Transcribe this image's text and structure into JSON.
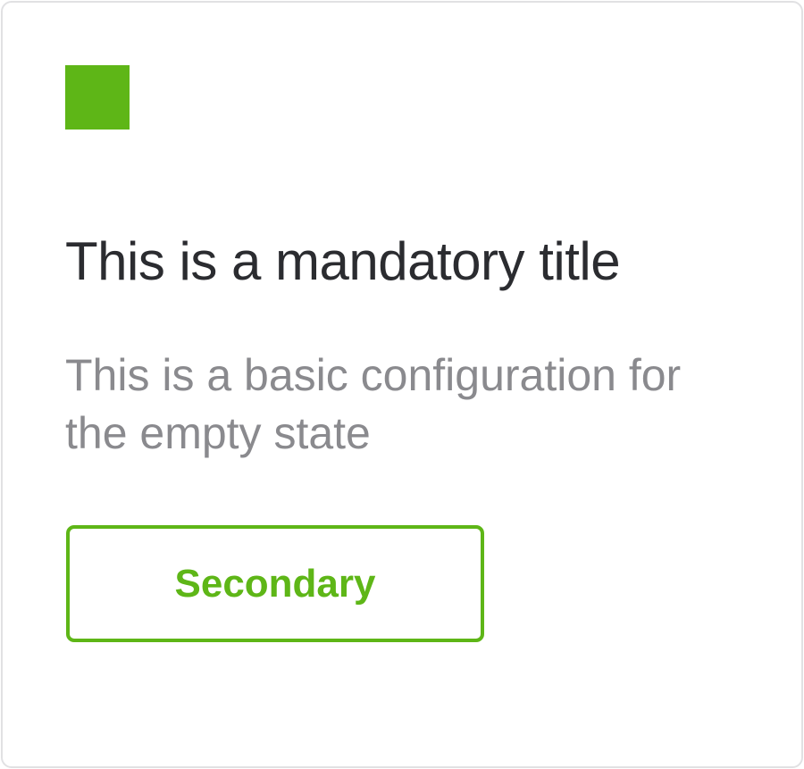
{
  "empty_state": {
    "illustration": {
      "icon": "green-square-icon",
      "color": "#5EB617"
    },
    "title": "This is a mandatory title",
    "description": "This is a basic configuration for the empty state",
    "secondary_button_label": "Secondary"
  },
  "colors": {
    "accent": "#5EB617",
    "title_text": "#2B2C30",
    "description_text": "#8A8A8E",
    "card_border": "#E1E1E3"
  }
}
